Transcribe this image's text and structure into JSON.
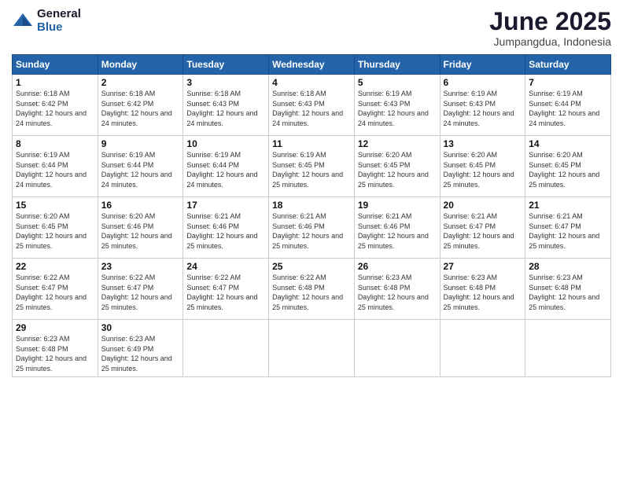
{
  "logo": {
    "general": "General",
    "blue": "Blue"
  },
  "header": {
    "month": "June 2025",
    "location": "Jumpangdua, Indonesia"
  },
  "days_of_week": [
    "Sunday",
    "Monday",
    "Tuesday",
    "Wednesday",
    "Thursday",
    "Friday",
    "Saturday"
  ],
  "weeks": [
    [
      {
        "day": "1",
        "sunrise": "6:18 AM",
        "sunset": "6:42 PM",
        "daylight": "12 hours and 24 minutes."
      },
      {
        "day": "2",
        "sunrise": "6:18 AM",
        "sunset": "6:42 PM",
        "daylight": "12 hours and 24 minutes."
      },
      {
        "day": "3",
        "sunrise": "6:18 AM",
        "sunset": "6:43 PM",
        "daylight": "12 hours and 24 minutes."
      },
      {
        "day": "4",
        "sunrise": "6:18 AM",
        "sunset": "6:43 PM",
        "daylight": "12 hours and 24 minutes."
      },
      {
        "day": "5",
        "sunrise": "6:19 AM",
        "sunset": "6:43 PM",
        "daylight": "12 hours and 24 minutes."
      },
      {
        "day": "6",
        "sunrise": "6:19 AM",
        "sunset": "6:43 PM",
        "daylight": "12 hours and 24 minutes."
      },
      {
        "day": "7",
        "sunrise": "6:19 AM",
        "sunset": "6:44 PM",
        "daylight": "12 hours and 24 minutes."
      }
    ],
    [
      {
        "day": "8",
        "sunrise": "6:19 AM",
        "sunset": "6:44 PM",
        "daylight": "12 hours and 24 minutes."
      },
      {
        "day": "9",
        "sunrise": "6:19 AM",
        "sunset": "6:44 PM",
        "daylight": "12 hours and 24 minutes."
      },
      {
        "day": "10",
        "sunrise": "6:19 AM",
        "sunset": "6:44 PM",
        "daylight": "12 hours and 24 minutes."
      },
      {
        "day": "11",
        "sunrise": "6:19 AM",
        "sunset": "6:45 PM",
        "daylight": "12 hours and 25 minutes."
      },
      {
        "day": "12",
        "sunrise": "6:20 AM",
        "sunset": "6:45 PM",
        "daylight": "12 hours and 25 minutes."
      },
      {
        "day": "13",
        "sunrise": "6:20 AM",
        "sunset": "6:45 PM",
        "daylight": "12 hours and 25 minutes."
      },
      {
        "day": "14",
        "sunrise": "6:20 AM",
        "sunset": "6:45 PM",
        "daylight": "12 hours and 25 minutes."
      }
    ],
    [
      {
        "day": "15",
        "sunrise": "6:20 AM",
        "sunset": "6:45 PM",
        "daylight": "12 hours and 25 minutes."
      },
      {
        "day": "16",
        "sunrise": "6:20 AM",
        "sunset": "6:46 PM",
        "daylight": "12 hours and 25 minutes."
      },
      {
        "day": "17",
        "sunrise": "6:21 AM",
        "sunset": "6:46 PM",
        "daylight": "12 hours and 25 minutes."
      },
      {
        "day": "18",
        "sunrise": "6:21 AM",
        "sunset": "6:46 PM",
        "daylight": "12 hours and 25 minutes."
      },
      {
        "day": "19",
        "sunrise": "6:21 AM",
        "sunset": "6:46 PM",
        "daylight": "12 hours and 25 minutes."
      },
      {
        "day": "20",
        "sunrise": "6:21 AM",
        "sunset": "6:47 PM",
        "daylight": "12 hours and 25 minutes."
      },
      {
        "day": "21",
        "sunrise": "6:21 AM",
        "sunset": "6:47 PM",
        "daylight": "12 hours and 25 minutes."
      }
    ],
    [
      {
        "day": "22",
        "sunrise": "6:22 AM",
        "sunset": "6:47 PM",
        "daylight": "12 hours and 25 minutes."
      },
      {
        "day": "23",
        "sunrise": "6:22 AM",
        "sunset": "6:47 PM",
        "daylight": "12 hours and 25 minutes."
      },
      {
        "day": "24",
        "sunrise": "6:22 AM",
        "sunset": "6:47 PM",
        "daylight": "12 hours and 25 minutes."
      },
      {
        "day": "25",
        "sunrise": "6:22 AM",
        "sunset": "6:48 PM",
        "daylight": "12 hours and 25 minutes."
      },
      {
        "day": "26",
        "sunrise": "6:23 AM",
        "sunset": "6:48 PM",
        "daylight": "12 hours and 25 minutes."
      },
      {
        "day": "27",
        "sunrise": "6:23 AM",
        "sunset": "6:48 PM",
        "daylight": "12 hours and 25 minutes."
      },
      {
        "day": "28",
        "sunrise": "6:23 AM",
        "sunset": "6:48 PM",
        "daylight": "12 hours and 25 minutes."
      }
    ],
    [
      {
        "day": "29",
        "sunrise": "6:23 AM",
        "sunset": "6:48 PM",
        "daylight": "12 hours and 25 minutes."
      },
      {
        "day": "30",
        "sunrise": "6:23 AM",
        "sunset": "6:49 PM",
        "daylight": "12 hours and 25 minutes."
      },
      null,
      null,
      null,
      null,
      null
    ]
  ]
}
